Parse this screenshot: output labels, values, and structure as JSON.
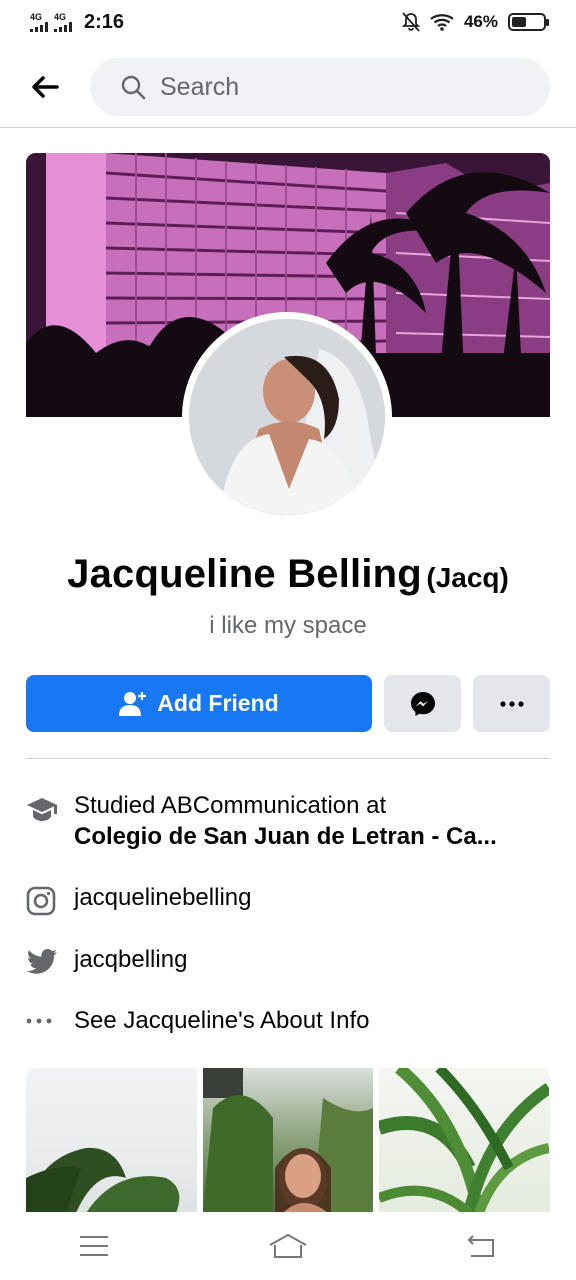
{
  "status_bar": {
    "network_1": "4G",
    "network_2": "4G",
    "time": "2:16",
    "battery_percent": "46%",
    "battery_level": 0.46
  },
  "search": {
    "placeholder": "Search"
  },
  "profile": {
    "name": "Jacqueline Belling",
    "nickname": "(Jacq)",
    "bio": "i like my space"
  },
  "actions": {
    "add_friend_label": "Add Friend"
  },
  "info": {
    "education_line1": "Studied ABCommunication at",
    "education_line2": "Colegio de San Juan de Letran - Ca...",
    "instagram": "jacquelinebelling",
    "twitter": "jacqbelling",
    "about_link": "See Jacqueline's About Info"
  },
  "colors": {
    "primary": "#1877f2",
    "secondary_bg": "#e4e6eb",
    "muted_text": "#65676b"
  }
}
